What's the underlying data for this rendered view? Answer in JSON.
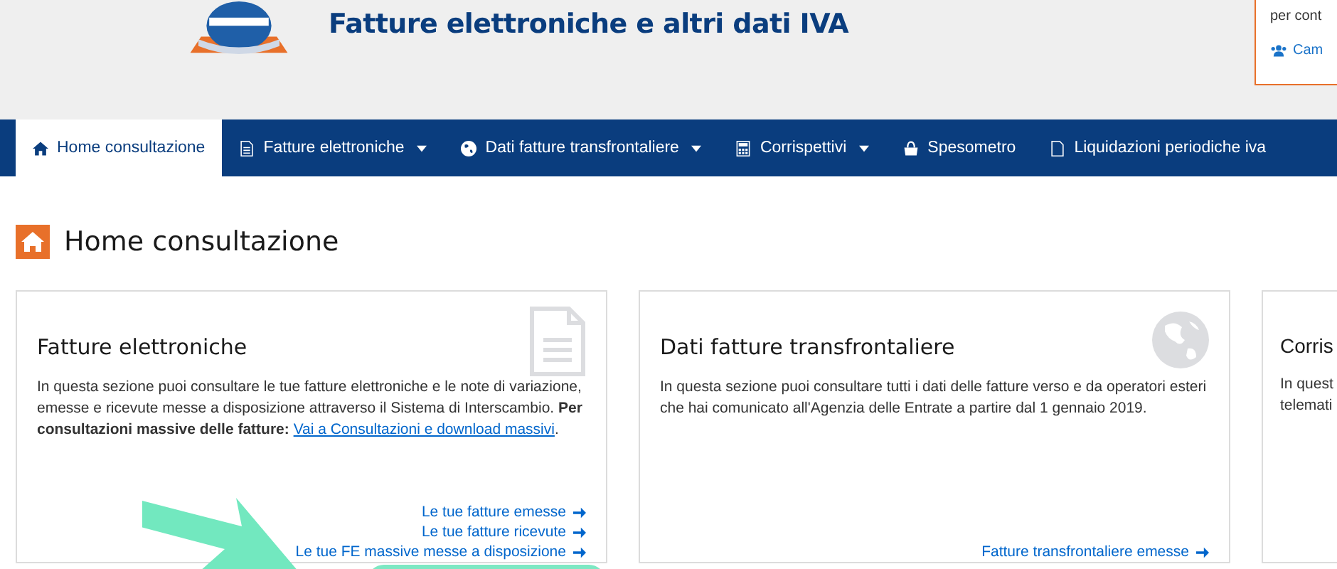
{
  "header": {
    "title": "Fatture elettroniche e altri dati IVA",
    "account_box": {
      "text": "per cont",
      "link": "Cam"
    }
  },
  "nav": {
    "items": [
      {
        "label": "Home consultazione",
        "dropdown": false,
        "selected": true
      },
      {
        "label": "Fatture elettroniche",
        "dropdown": true,
        "selected": false
      },
      {
        "label": "Dati fatture transfrontaliere",
        "dropdown": true,
        "selected": false
      },
      {
        "label": "Corrispettivi",
        "dropdown": true,
        "selected": false
      },
      {
        "label": "Spesometro",
        "dropdown": false,
        "selected": false
      },
      {
        "label": "Liquidazioni periodiche iva",
        "dropdown": false,
        "selected": false
      }
    ]
  },
  "page_title": "Home consultazione",
  "cards": [
    {
      "title": "Fatture elettroniche",
      "description": "In questa sezione puoi consultare le tue fatture elettroniche e le note di variazione, emesse e ricevute messe a disposizione attraverso il Sistema di Interscambio. **Per consultazioni massive delle fatture:** ",
      "inline_link": "Vai a Consultazioni e download massivi",
      "description_end": ".",
      "links": [
        "Le tue fatture emesse",
        "Le tue fatture ricevute",
        "Le tue FE massive messe a disposizione"
      ]
    },
    {
      "title": "Dati fatture transfrontaliere",
      "description": "In questa sezione puoi consultare tutti i dati delle fatture verso e da operatori esteri che hai comunicato all'Agenzia delle Entrate a partire dal 1 gennaio 2019.",
      "links": [
        "Fatture transfrontaliere emesse"
      ]
    },
    {
      "title": "Corris",
      "description": "In quest telemati"
    }
  ]
}
